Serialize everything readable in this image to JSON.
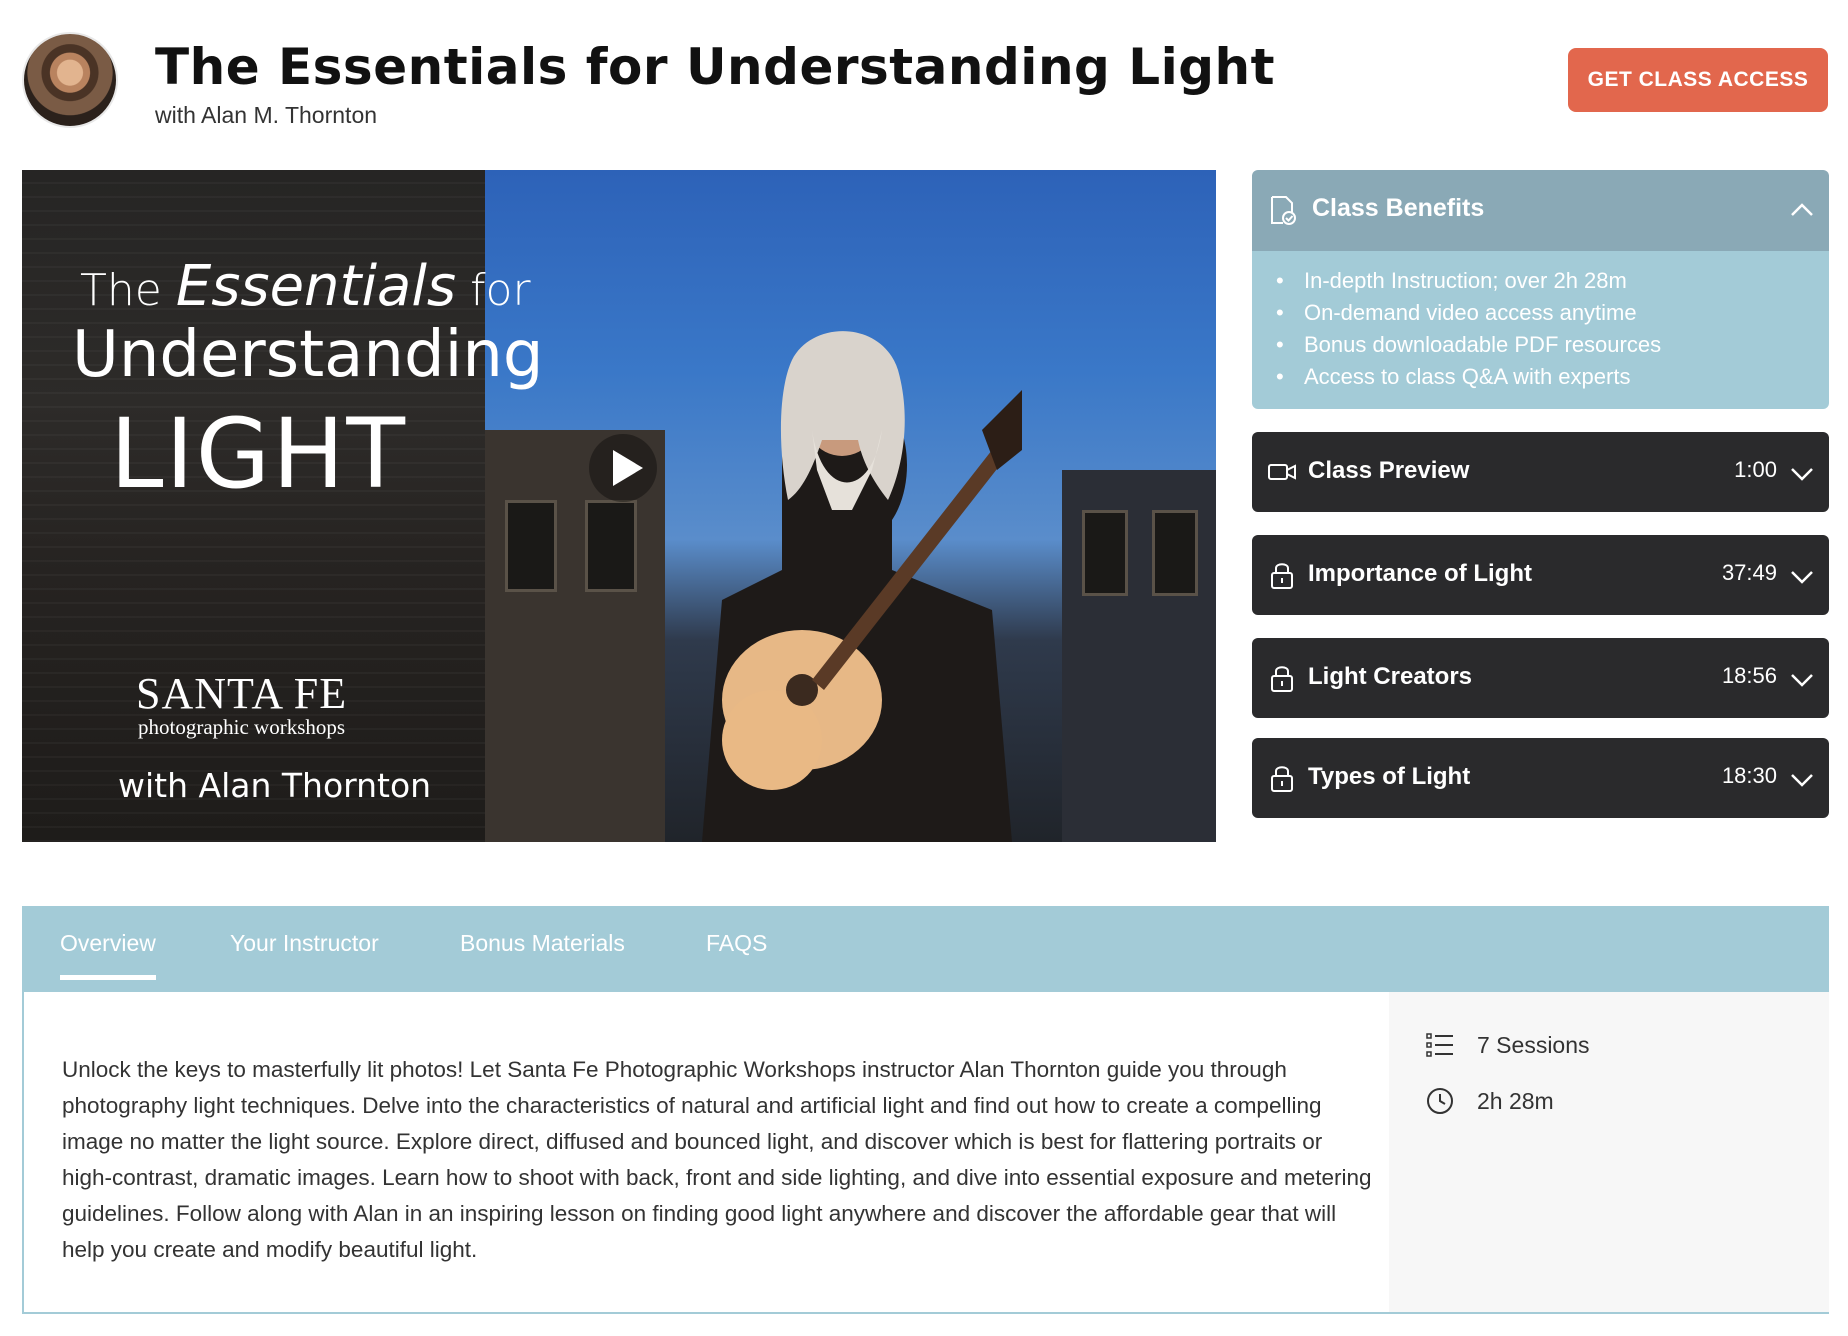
{
  "header": {
    "title": "The Essentials for Understanding Light",
    "subtitle": "with Alan M. Thornton",
    "cta_label": "GET CLASS ACCESS"
  },
  "video": {
    "overlay_line1_a": "The ",
    "overlay_line1_b": "Essentials",
    "overlay_line1_c": " for",
    "overlay_line2": "Understanding",
    "overlay_line3": "LIGHT",
    "overlay_brand": "SANTA FE",
    "overlay_brand_sub": "photographic workshops",
    "overlay_with": "with Alan Thornton"
  },
  "benefits": {
    "title": "Class Benefits",
    "items": [
      "In-depth Instruction; over 2h 28m",
      "On-demand video access anytime",
      "Bonus downloadable PDF resources",
      "Access to class Q&A with experts"
    ]
  },
  "sessions": [
    {
      "label": "Class Preview",
      "duration": "1:00",
      "icon": "video-camera-icon"
    },
    {
      "label": "Importance of Light",
      "duration": "37:49",
      "icon": "lock-icon"
    },
    {
      "label": "Light Creators",
      "duration": "18:56",
      "icon": "lock-icon"
    },
    {
      "label": "Types of Light",
      "duration": "18:30",
      "icon": "lock-icon"
    }
  ],
  "tabs": [
    "Overview",
    "Your Instructor",
    "Bonus Materials",
    "FAQS"
  ],
  "overview": {
    "description": "Unlock the keys to masterfully lit photos! Let Santa Fe Photographic Workshops instructor Alan Thornton guide you through photography light techniques. Delve into the characteristics of natural and artificial light and find out how to create a compelling image no matter the light source. Explore direct, diffused and bounced light, and discover which is best for flattering portraits or high-contrast, dramatic images. Learn how to shoot with back, front and side lighting, and dive into essential exposure and metering guidelines. Follow along with Alan in an inspiring lesson on finding good light anywhere and discover the affordable gear that will help you create and modify beautiful light.",
    "sessions_count": "7 Sessions",
    "total_duration": "2h 28m"
  },
  "colors": {
    "cta": "#e2674d",
    "benefits_head": "#8aa9b6",
    "benefits_body": "#a3cbd7",
    "session_bg": "#2a2a2c",
    "tab_bar": "#a3cbd7"
  }
}
